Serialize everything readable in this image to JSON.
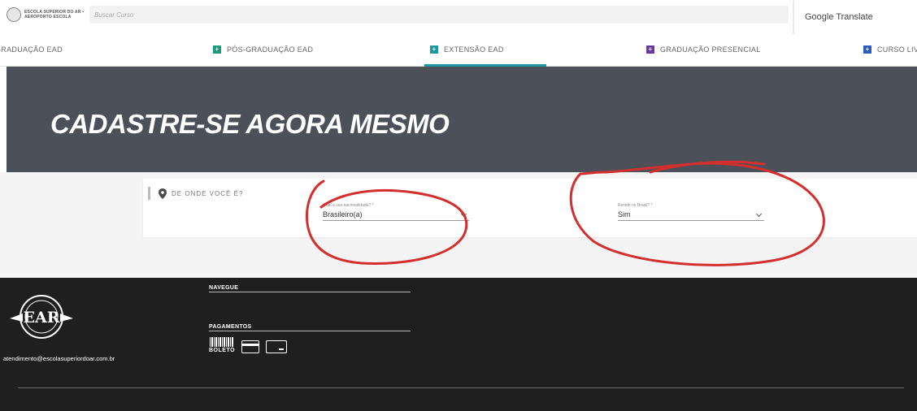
{
  "header": {
    "logo_text": "ESCOLA SUPERIOR DO AR • AEROPORTO ESCOLA",
    "search_placeholder": "Buscar Curso",
    "translate_label": "Google Translate"
  },
  "nav": {
    "items": [
      {
        "label": "GRADUAÇÃO EAD",
        "color": ""
      },
      {
        "label": "PÓS-GRADUAÇÃO EAD",
        "color": "#1a9a7c"
      },
      {
        "label": "EXTENSÃO EAD",
        "color": "#1a9aa0"
      },
      {
        "label": "GRADUAÇÃO PRESENCIAL",
        "color": "#6a3aa2"
      },
      {
        "label": "CURSO LIVRE",
        "color": "#2a5bbf"
      }
    ]
  },
  "hero": {
    "title": "CADASTRE-SE AGORA MESMO",
    "background_color": "#4c5059"
  },
  "form": {
    "section_label": "DE ONDE VOCÊ É?",
    "nationality": {
      "label": "Qual a sua nacionalidade? *",
      "value": "Brasileiro(a)"
    },
    "lives_in_brazil": {
      "label": "Reside no Brasil? *",
      "value": "Sim"
    }
  },
  "annotations": {
    "color": "#d32f2f"
  },
  "footer": {
    "logo_text": "EAR",
    "email": "atendimento@escolasuperiordoar.com.br",
    "navegue_heading": "NAVEGUE",
    "pagamentos_heading": "PAGAMENTOS",
    "boleto_label": "BOLETO"
  }
}
